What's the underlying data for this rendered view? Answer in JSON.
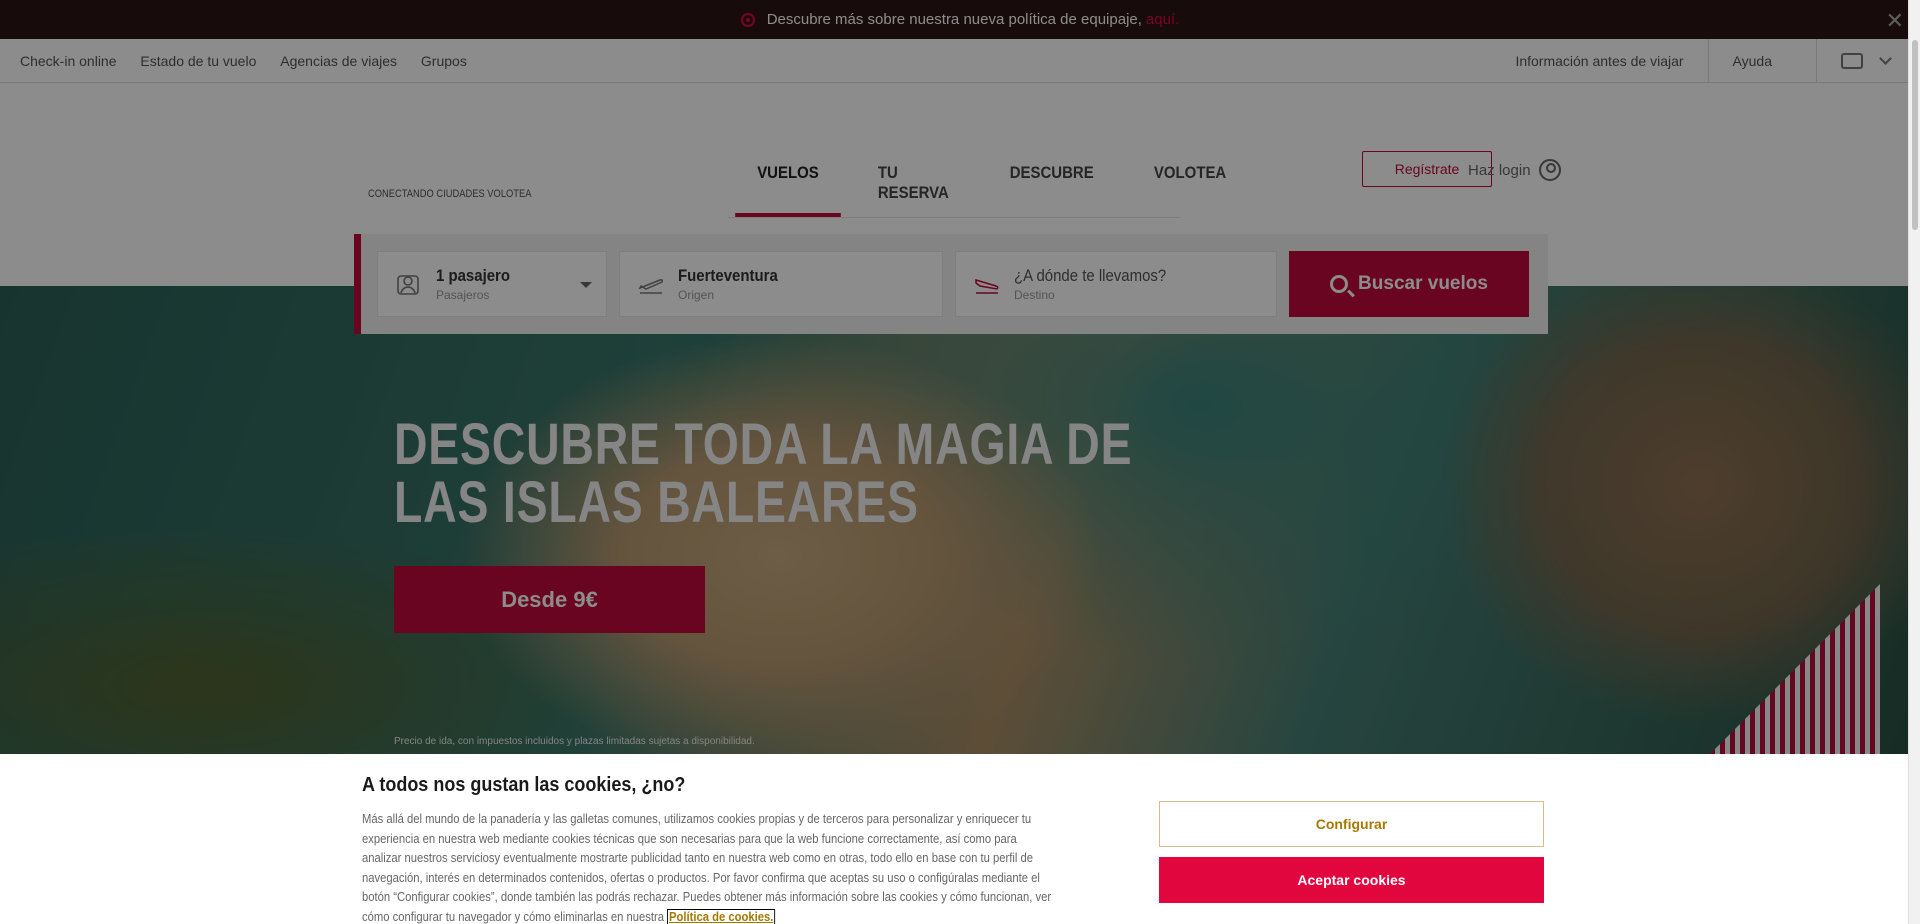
{
  "banner": {
    "text": "Descubre más sobre nuestra nueva política de equipaje,",
    "link": "aquí."
  },
  "utilbar": {
    "left": [
      "Check-in online",
      "Estado de tu vuelo",
      "Agencias de viajes",
      "Grupos"
    ],
    "info": "Información antes de viajar",
    "help": "Ayuda"
  },
  "header": {
    "tagline": "CONECTANDO CIUDADES VOLOTEA",
    "tabs": [
      "VUELOS",
      "TU RESERVA",
      "DESCUBRE",
      "VOLOTEA"
    ],
    "register": "Regístrate",
    "login": "Haz login"
  },
  "search": {
    "passengers": {
      "value": "1 pasajero",
      "label": "Pasajeros"
    },
    "origin": {
      "value": "Fuerteventura",
      "label": "Origen"
    },
    "destination": {
      "placeholder": "¿A dónde te llevamos?",
      "label": "Destino"
    },
    "button": "Buscar vuelos"
  },
  "hero": {
    "title_line1": "DESCUBRE TODA LA MAGIA DE",
    "title_line2": "LAS ISLAS BALEARES",
    "cta": "Desde 9€",
    "note": "Precio de ida, con impuestos incluidos y plazas limitadas sujetas a disponibilidad."
  },
  "cookie": {
    "title": "A todos nos gustan las cookies, ¿no?",
    "body": "Más allá del mundo de la panadería y las galletas comunes, utilizamos cookies propias y de terceros para personalizar y enriquecer tu experiencia en nuestra web mediante cookies técnicas que son necesarias para que la web funcione correctamente, así como para analizar nuestros serviciosy eventualmente mostrarte publicidad tanto en nuestra web como en otras, todo ello en base con tu perfil de navegación, interés en determinados contenidos, ofertas o productos. Por favor confirma que aceptas su uso o configúralas mediante el botón “Configurar cookies”, donde también las podrás rechazar. Puedes obtener más información sobre las cookies y cómo funcionan, ver cómo configurar tu navegador y cómo eliminarlas en nuestra",
    "policy_link": "Política de cookies.",
    "configure": "Configurar",
    "accept": "Aceptar cookies"
  },
  "colors": {
    "brand": "#c0093c",
    "accept": "#e2063f",
    "gold": "#a57900",
    "banner": "#2b1417"
  }
}
